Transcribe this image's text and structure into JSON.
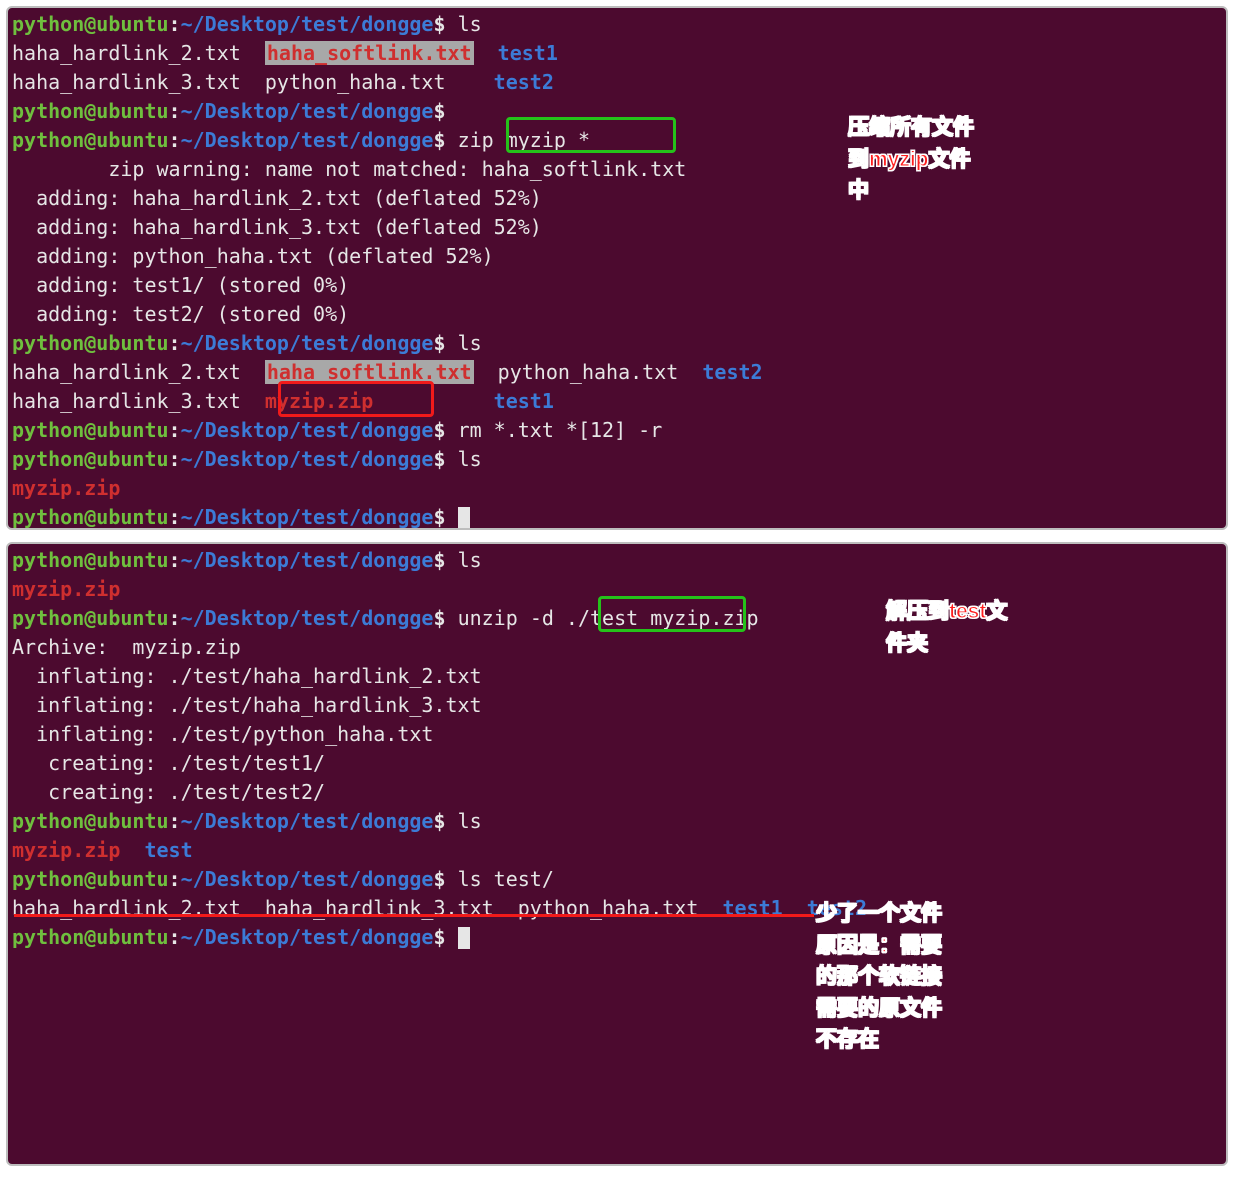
{
  "prompt": {
    "user": "python@ubuntu",
    "sep": ":",
    "path": "~/Desktop/test/dongge",
    "sign": "$"
  },
  "t1": {
    "cmd_ls1": "ls",
    "ls1_r1_c1": "haha_hardlink_2.txt",
    "ls1_r1_c2": "haha_softlink.txt",
    "ls1_r1_c3": "test1",
    "ls1_r2_c1": "haha_hardlink_3.txt",
    "ls1_r2_c2": "python_haha.txt",
    "ls1_r2_c3": "test2",
    "cmd_zip": "zip myzip *",
    "zip_warn": "        zip warning: name not matched: haha_softlink.txt",
    "zip_add1": "  adding: haha_hardlink_2.txt (deflated 52%)",
    "zip_add2": "  adding: haha_hardlink_3.txt (deflated 52%)",
    "zip_add3": "  adding: python_haha.txt (deflated 52%)",
    "zip_add4": "  adding: test1/ (stored 0%)",
    "zip_add5": "  adding: test2/ (stored 0%)",
    "cmd_ls2": "ls",
    "ls2_r1_c1": "haha_hardlink_2.txt",
    "ls2_r1_c2": "haha_softlink.txt",
    "ls2_r1_c3": "python_haha.txt",
    "ls2_r1_c4": "test2",
    "ls2_r2_c1": "haha_hardlink_3.txt",
    "ls2_r2_c2": "myzip.zip",
    "ls2_r2_c3": "test1",
    "cmd_rm": "rm *.txt *[12] -r",
    "cmd_ls3": "ls",
    "ls3_r1": "myzip.zip",
    "anno1_l1": "压缩所有文件",
    "anno1_l2": "到myzip文件",
    "anno1_l3": "中"
  },
  "t2": {
    "cmd_ls1": "ls",
    "ls1_r1": "myzip.zip",
    "cmd_unzip_a": "unzip ",
    "cmd_unzip_b": "-d ./test",
    "cmd_unzip_c": " myzip.zip",
    "unzip_arc": "Archive:  myzip.zip",
    "unzip_l1": "  inflating: ./test/haha_hardlink_2.txt  ",
    "unzip_l2": "  inflating: ./test/haha_hardlink_3.txt  ",
    "unzip_l3": "  inflating: ./test/python_haha.txt  ",
    "unzip_l4": "   creating: ./test/test1/",
    "unzip_l5": "   creating: ./test/test2/",
    "cmd_ls2": "ls",
    "ls2_c1": "myzip.zip",
    "ls2_c2": "test",
    "cmd_ls3": "ls test/",
    "ls3_c1": "haha_hardlink_2.txt",
    "ls3_c2": "haha_hardlink_3.txt",
    "ls3_c3": "python_haha.txt",
    "ls3_c4": "test1",
    "ls3_c5": "test2",
    "anno2_l1": "解压到test文",
    "anno2_l2": "件夹",
    "anno3_l1": "少了一个文件",
    "anno3_l2": "原因是：需要",
    "anno3_l3": "的那个软链接",
    "anno3_l4": "需要的原文件",
    "anno3_l5": "不存在"
  }
}
